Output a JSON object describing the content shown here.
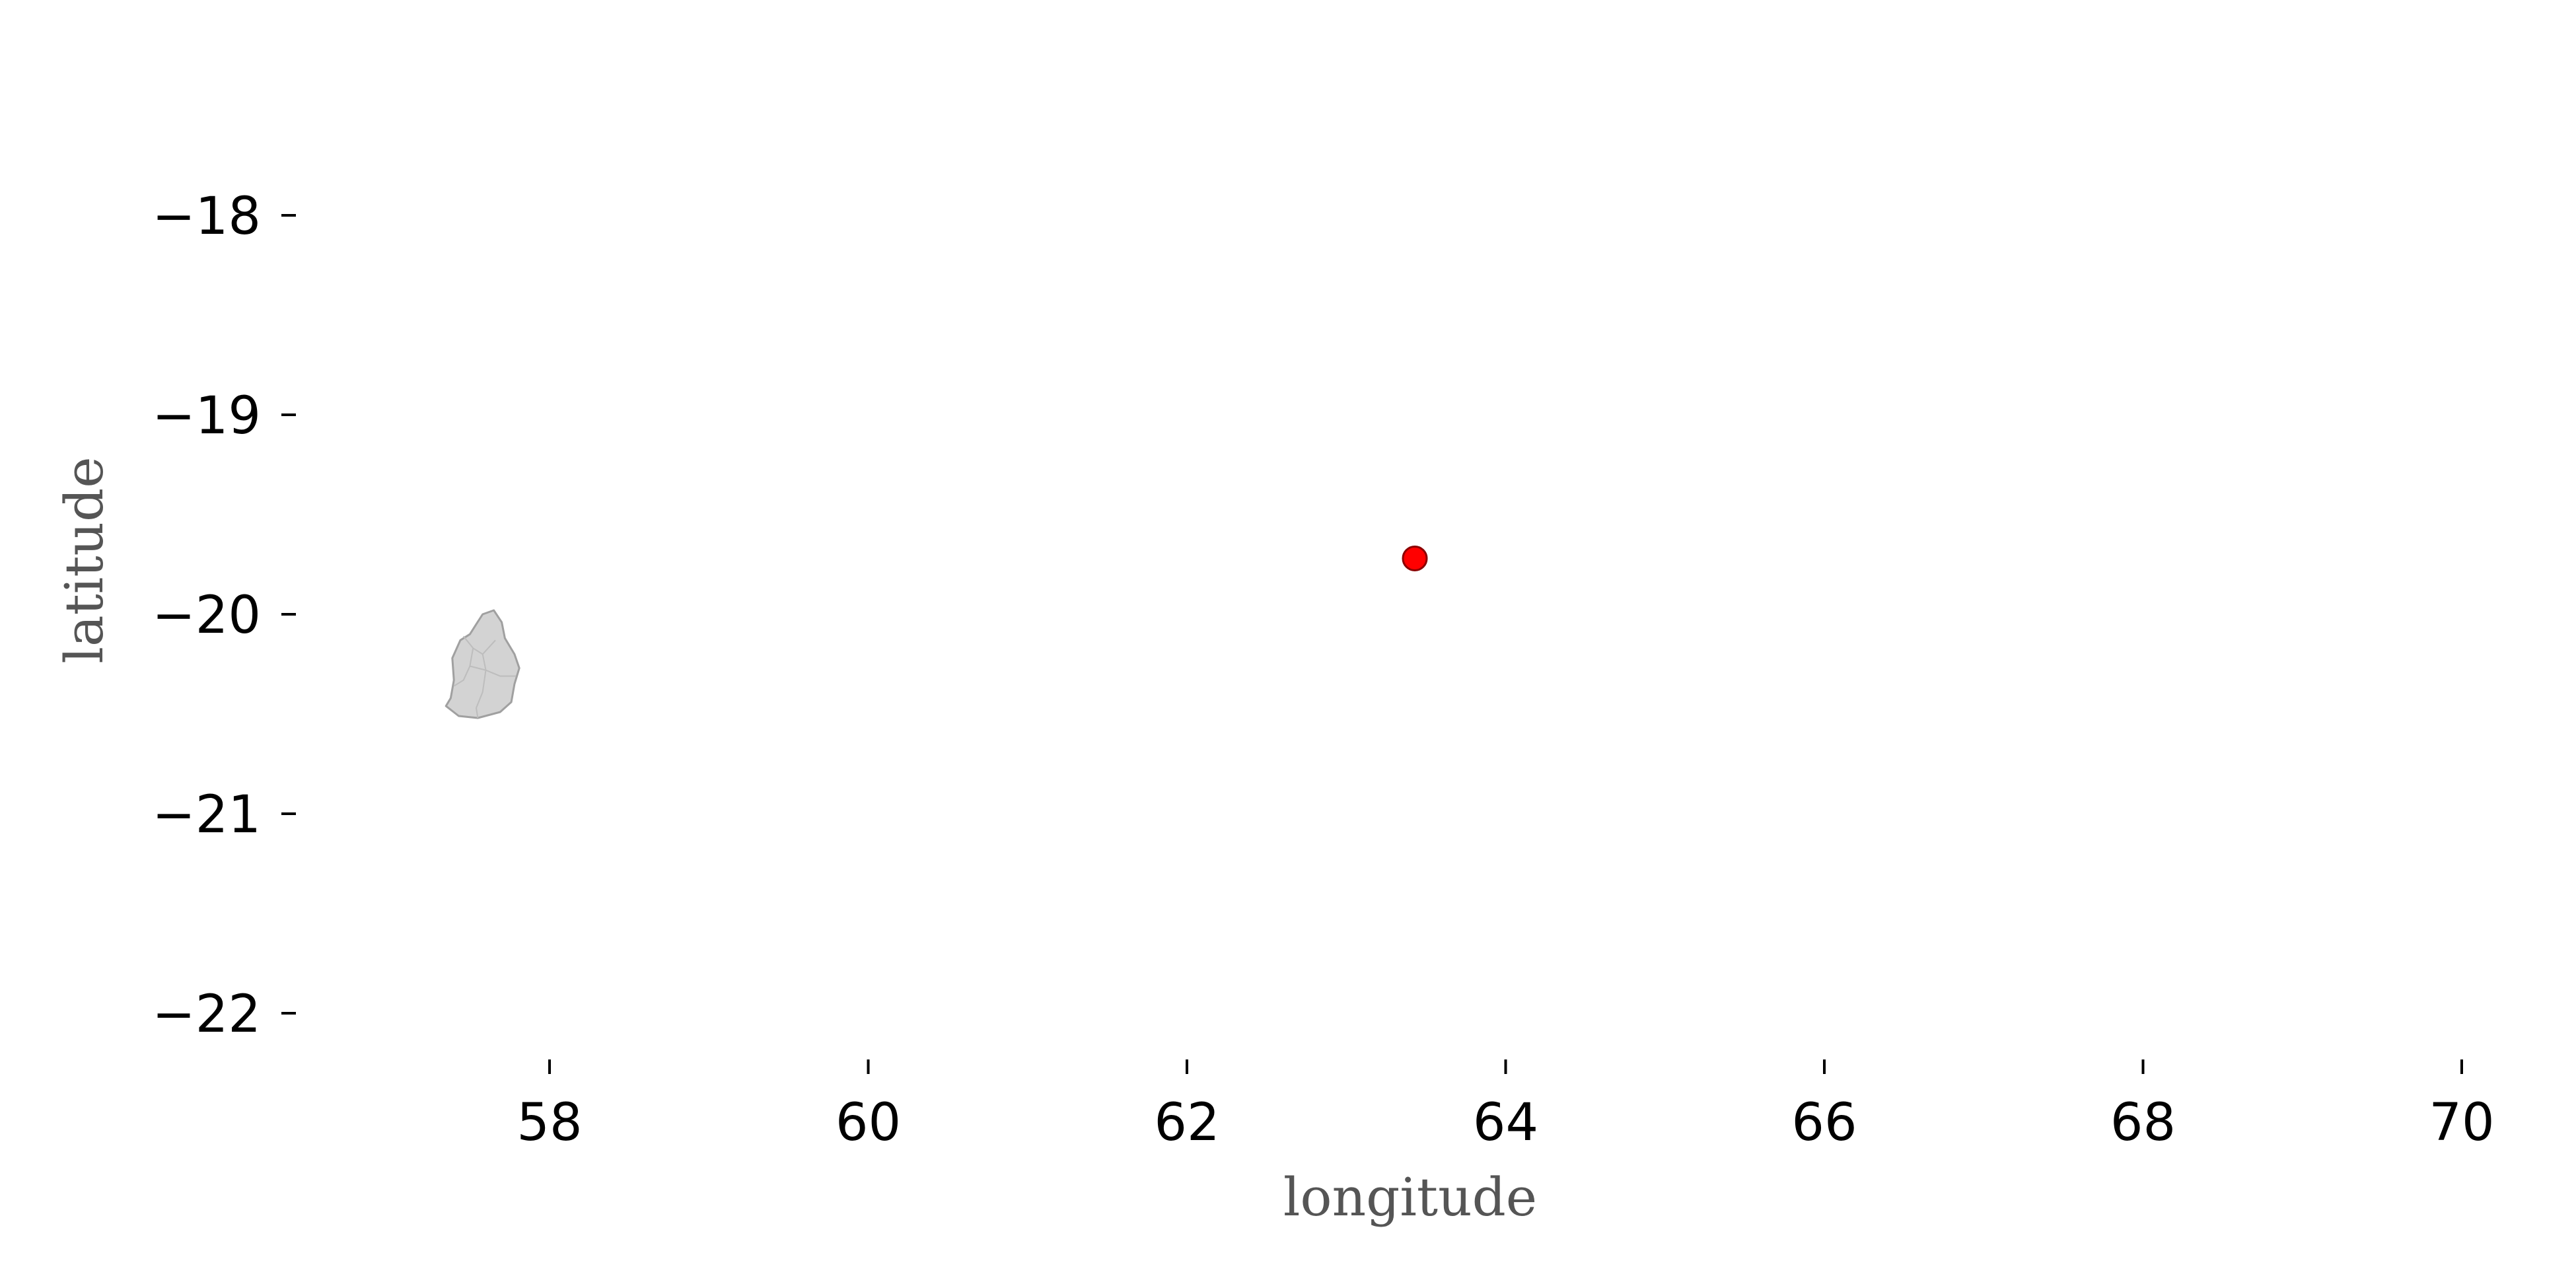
{
  "chart_data": {
    "type": "scatter",
    "title": "",
    "xlabel": "longitude",
    "ylabel": "latitude",
    "xlim": [
      56.2,
      70.2
    ],
    "ylim": [
      -22.3,
      -17.3
    ],
    "x_ticks": [
      58,
      60,
      62,
      64,
      66,
      68,
      70
    ],
    "y_ticks": [
      -18,
      -19,
      -20,
      -21,
      -22
    ],
    "x_tick_labels": [
      "58",
      "60",
      "62",
      "64",
      "66",
      "68",
      "70"
    ],
    "y_tick_labels": [
      "−18",
      "−19",
      "−20",
      "−21",
      "−22"
    ],
    "grid": false,
    "points": [
      {
        "x": 63.43,
        "y": -19.72,
        "color": "#ff0000",
        "edge_color": "#8b0000"
      }
    ],
    "land": {
      "name": "Mauritius",
      "fill": "#d3d3d3",
      "edge_color": "#a0a0a0",
      "outline_lonlat": [
        [
          57.58,
          -20.0
        ],
        [
          57.65,
          -19.98
        ],
        [
          57.7,
          -20.04
        ],
        [
          57.72,
          -20.12
        ],
        [
          57.78,
          -20.2
        ],
        [
          57.81,
          -20.27
        ],
        [
          57.78,
          -20.35
        ],
        [
          57.76,
          -20.44
        ],
        [
          57.69,
          -20.49
        ],
        [
          57.55,
          -20.52
        ],
        [
          57.43,
          -20.51
        ],
        [
          57.35,
          -20.46
        ],
        [
          57.38,
          -20.42
        ],
        [
          57.4,
          -20.33
        ],
        [
          57.39,
          -20.22
        ],
        [
          57.44,
          -20.13
        ],
        [
          57.5,
          -20.1
        ],
        [
          57.54,
          -20.05
        ]
      ],
      "district_lines_lonlat": [
        [
          [
            57.46,
            -20.11
          ],
          [
            57.52,
            -20.17
          ],
          [
            57.58,
            -20.2
          ],
          [
            57.66,
            -20.13
          ]
        ],
        [
          [
            57.52,
            -20.17
          ],
          [
            57.5,
            -20.26
          ],
          [
            57.46,
            -20.33
          ],
          [
            57.4,
            -20.36
          ]
        ],
        [
          [
            57.5,
            -20.26
          ],
          [
            57.6,
            -20.28
          ],
          [
            57.69,
            -20.31
          ],
          [
            57.79,
            -20.31
          ]
        ],
        [
          [
            57.6,
            -20.28
          ],
          [
            57.58,
            -20.39
          ],
          [
            57.54,
            -20.47
          ],
          [
            57.55,
            -20.52
          ]
        ],
        [
          [
            57.58,
            -20.2
          ],
          [
            57.6,
            -20.28
          ]
        ]
      ]
    }
  }
}
